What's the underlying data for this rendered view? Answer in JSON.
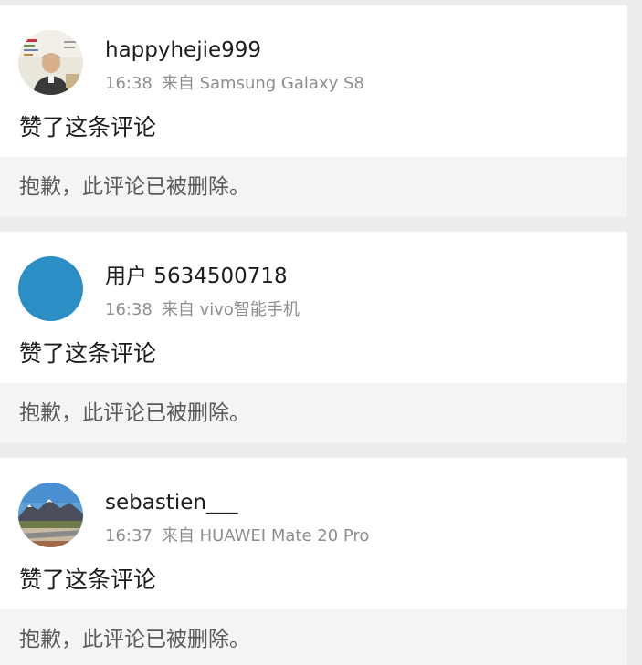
{
  "posts": [
    {
      "username": "happyhejie999",
      "time": "16:38",
      "source": "来自 Samsung Galaxy S8",
      "action": "赞了这条评论",
      "deleted_notice": "抱歉，此评论已被删除。",
      "avatar_icon": "person-photo-avatar"
    },
    {
      "username": "用户 5634500718",
      "time": "16:38",
      "source": "来自 vivo智能手机",
      "action": "赞了这条评论",
      "deleted_notice": "抱歉，此评论已被删除。",
      "avatar_icon": "blue-default-avatar"
    },
    {
      "username": "sebastien___",
      "time": "16:37",
      "source": "来自 HUAWEI Mate 20 Pro",
      "action": "赞了这条评论",
      "deleted_notice": "抱歉，此评论已被删除。",
      "avatar_icon": "mountain-landscape-avatar"
    }
  ],
  "colors": {
    "background": "#ececec",
    "card": "#ffffff",
    "deleted_box": "#f4f4f4",
    "meta_text": "#8e8e8e",
    "avatar_blue": "#2b8fc6"
  }
}
